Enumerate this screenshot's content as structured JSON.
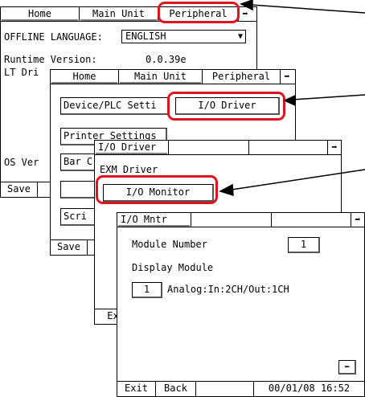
{
  "tabs": {
    "home": "Home",
    "main_unit": "Main Unit",
    "peripheral": "Peripheral",
    "next_arrow": "➡"
  },
  "screen1": {
    "offline_language_label": "OFFLINE LANGUAGE:",
    "offline_language_value": "ENGLISH",
    "runtime_version_label": "Runtime Version:",
    "runtime_version_value": "0.0.39e",
    "lt_label": "LT Dri",
    "os_label": "OS Ver",
    "save_label": "Save"
  },
  "screen2": {
    "device_plc_label": "Device/PLC Setti",
    "io_driver_button": "I/O Driver",
    "printer_settings": "Printer Settings",
    "bar_label": "Bar C",
    "script_label": "Scri",
    "save_label": "Save"
  },
  "screen3": {
    "tab_title": "I/O Driver",
    "exm_driver_label": "EXM Driver",
    "io_monitor_button": "I/O Monitor",
    "exit_label": "Ex"
  },
  "screen4": {
    "tab_title": "I/O Mntr",
    "module_number_label": "Module Number",
    "module_number_value": "1",
    "display_module_label": "Display Module",
    "display_module_value": "1",
    "display_module_desc": "Analog:In:2CH/Out:1CH",
    "exit_label": "Exit",
    "back_label": "Back",
    "datetime": "00/01/08 16:52",
    "back_arrow": "⬅"
  },
  "colors": {
    "callout": "#e0141e",
    "bevel": "#808080"
  }
}
